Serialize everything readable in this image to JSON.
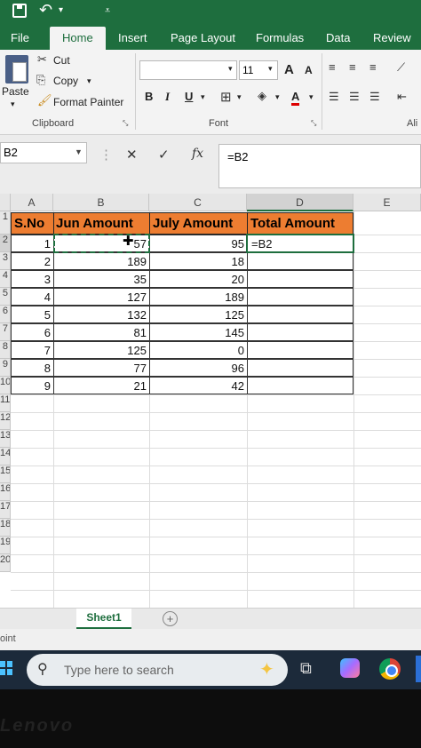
{
  "tabs": [
    "File",
    "Home",
    "Insert",
    "Page Layout",
    "Formulas",
    "Data",
    "Review"
  ],
  "active_tab": "Home",
  "clipboard": {
    "cut_label": "Cut",
    "copy_label": "Copy",
    "paste_label": "Paste",
    "format_painter_label": "Format Painter",
    "group_label": "Clipboard"
  },
  "font": {
    "font_name": "",
    "font_size": "11",
    "bold": "B",
    "italic": "I",
    "underline": "U",
    "grow": "A",
    "shrink": "A",
    "group_label": "Font"
  },
  "alignment_partial_label": "Ali",
  "formula_bar": {
    "name_box": "B2",
    "cancel": "✕",
    "enter": "✓",
    "fx": "fx",
    "formula": "=B2"
  },
  "columns": [
    "A",
    "B",
    "C",
    "D",
    "E"
  ],
  "rows": [
    "1",
    "2",
    "3",
    "4",
    "5",
    "6",
    "7",
    "8",
    "9",
    "10",
    "11",
    "12",
    "13",
    "14",
    "15",
    "16",
    "17",
    "18",
    "19",
    "20"
  ],
  "table": {
    "headers": [
      "S.No",
      "Jun Amount",
      "July Amount",
      "Total Amount"
    ],
    "rows": [
      [
        "1",
        "57",
        "95",
        "=B2"
      ],
      [
        "2",
        "189",
        "18",
        ""
      ],
      [
        "3",
        "35",
        "20",
        ""
      ],
      [
        "4",
        "127",
        "189",
        ""
      ],
      [
        "5",
        "132",
        "125",
        ""
      ],
      [
        "6",
        "81",
        "145",
        ""
      ],
      [
        "7",
        "125",
        "0",
        ""
      ],
      [
        "8",
        "77",
        "96",
        ""
      ],
      [
        "9",
        "21",
        "42",
        ""
      ]
    ],
    "header_color": "#ed7d31"
  },
  "sheet_tab": "Sheet1",
  "status_text": "oint",
  "taskbar": {
    "search_placeholder": "Type here to search"
  },
  "brand": "Lenovo",
  "accent_color": "#1e6e3e"
}
